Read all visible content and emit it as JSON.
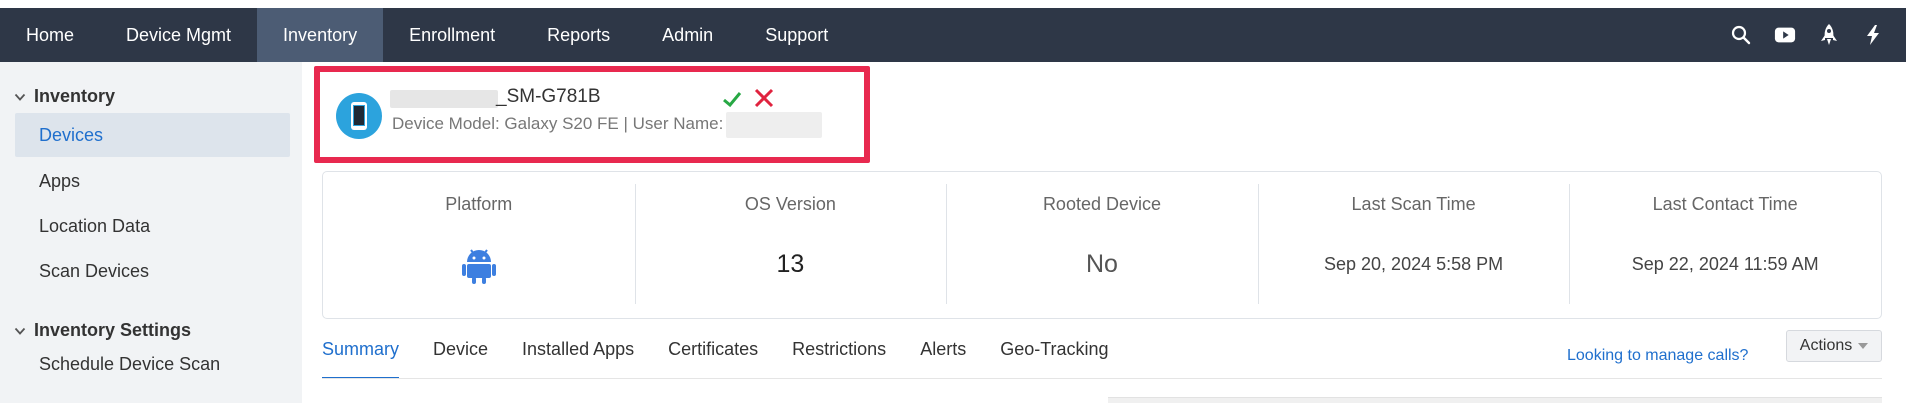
{
  "topnav": {
    "tabs": [
      {
        "label": "Home"
      },
      {
        "label": "Device Mgmt"
      },
      {
        "label": "Inventory"
      },
      {
        "label": "Enrollment"
      },
      {
        "label": "Reports"
      },
      {
        "label": "Admin"
      },
      {
        "label": "Support"
      }
    ],
    "active_tab": "Inventory",
    "icons": [
      "search-icon",
      "video-icon",
      "rocket-icon",
      "lightning-icon"
    ]
  },
  "sidebar": {
    "sections": [
      {
        "title": "Inventory",
        "items": [
          "Devices",
          "Apps",
          "Location Data",
          "Scan Devices"
        ]
      },
      {
        "title": "Inventory Settings",
        "items": [
          "Schedule Device Scan"
        ]
      }
    ],
    "active_item": "Devices"
  },
  "device": {
    "name": "_SM-G781B",
    "meta": "Device Model: Galaxy S20 FE | User Name:",
    "icon": "phone-icon",
    "status_icons": [
      "check-icon",
      "cross-icon"
    ]
  },
  "stats": [
    {
      "label": "Platform",
      "value": "",
      "icon": "android-icon"
    },
    {
      "label": "OS Version",
      "value": "13"
    },
    {
      "label": "Rooted Device",
      "value": "No"
    },
    {
      "label": "Last Scan Time",
      "value": "Sep 20, 2024 5:58 PM"
    },
    {
      "label": "Last Contact Time",
      "value": "Sep 22, 2024 11:59 AM"
    }
  ],
  "tabs": [
    {
      "label": "Summary"
    },
    {
      "label": "Device"
    },
    {
      "label": "Installed Apps"
    },
    {
      "label": "Certificates"
    },
    {
      "label": "Restrictions"
    },
    {
      "label": "Alerts"
    },
    {
      "label": "Geo-Tracking"
    }
  ],
  "active_tab": "Summary",
  "help_link": "Looking to manage calls?",
  "actions_label": "Actions",
  "colors": {
    "nav_bg": "#2e3747",
    "nav_active": "#4c5c74",
    "accent": "#1f6fcd",
    "highlight_border": "#e8294f",
    "android_blue": "#3d7fe0"
  }
}
